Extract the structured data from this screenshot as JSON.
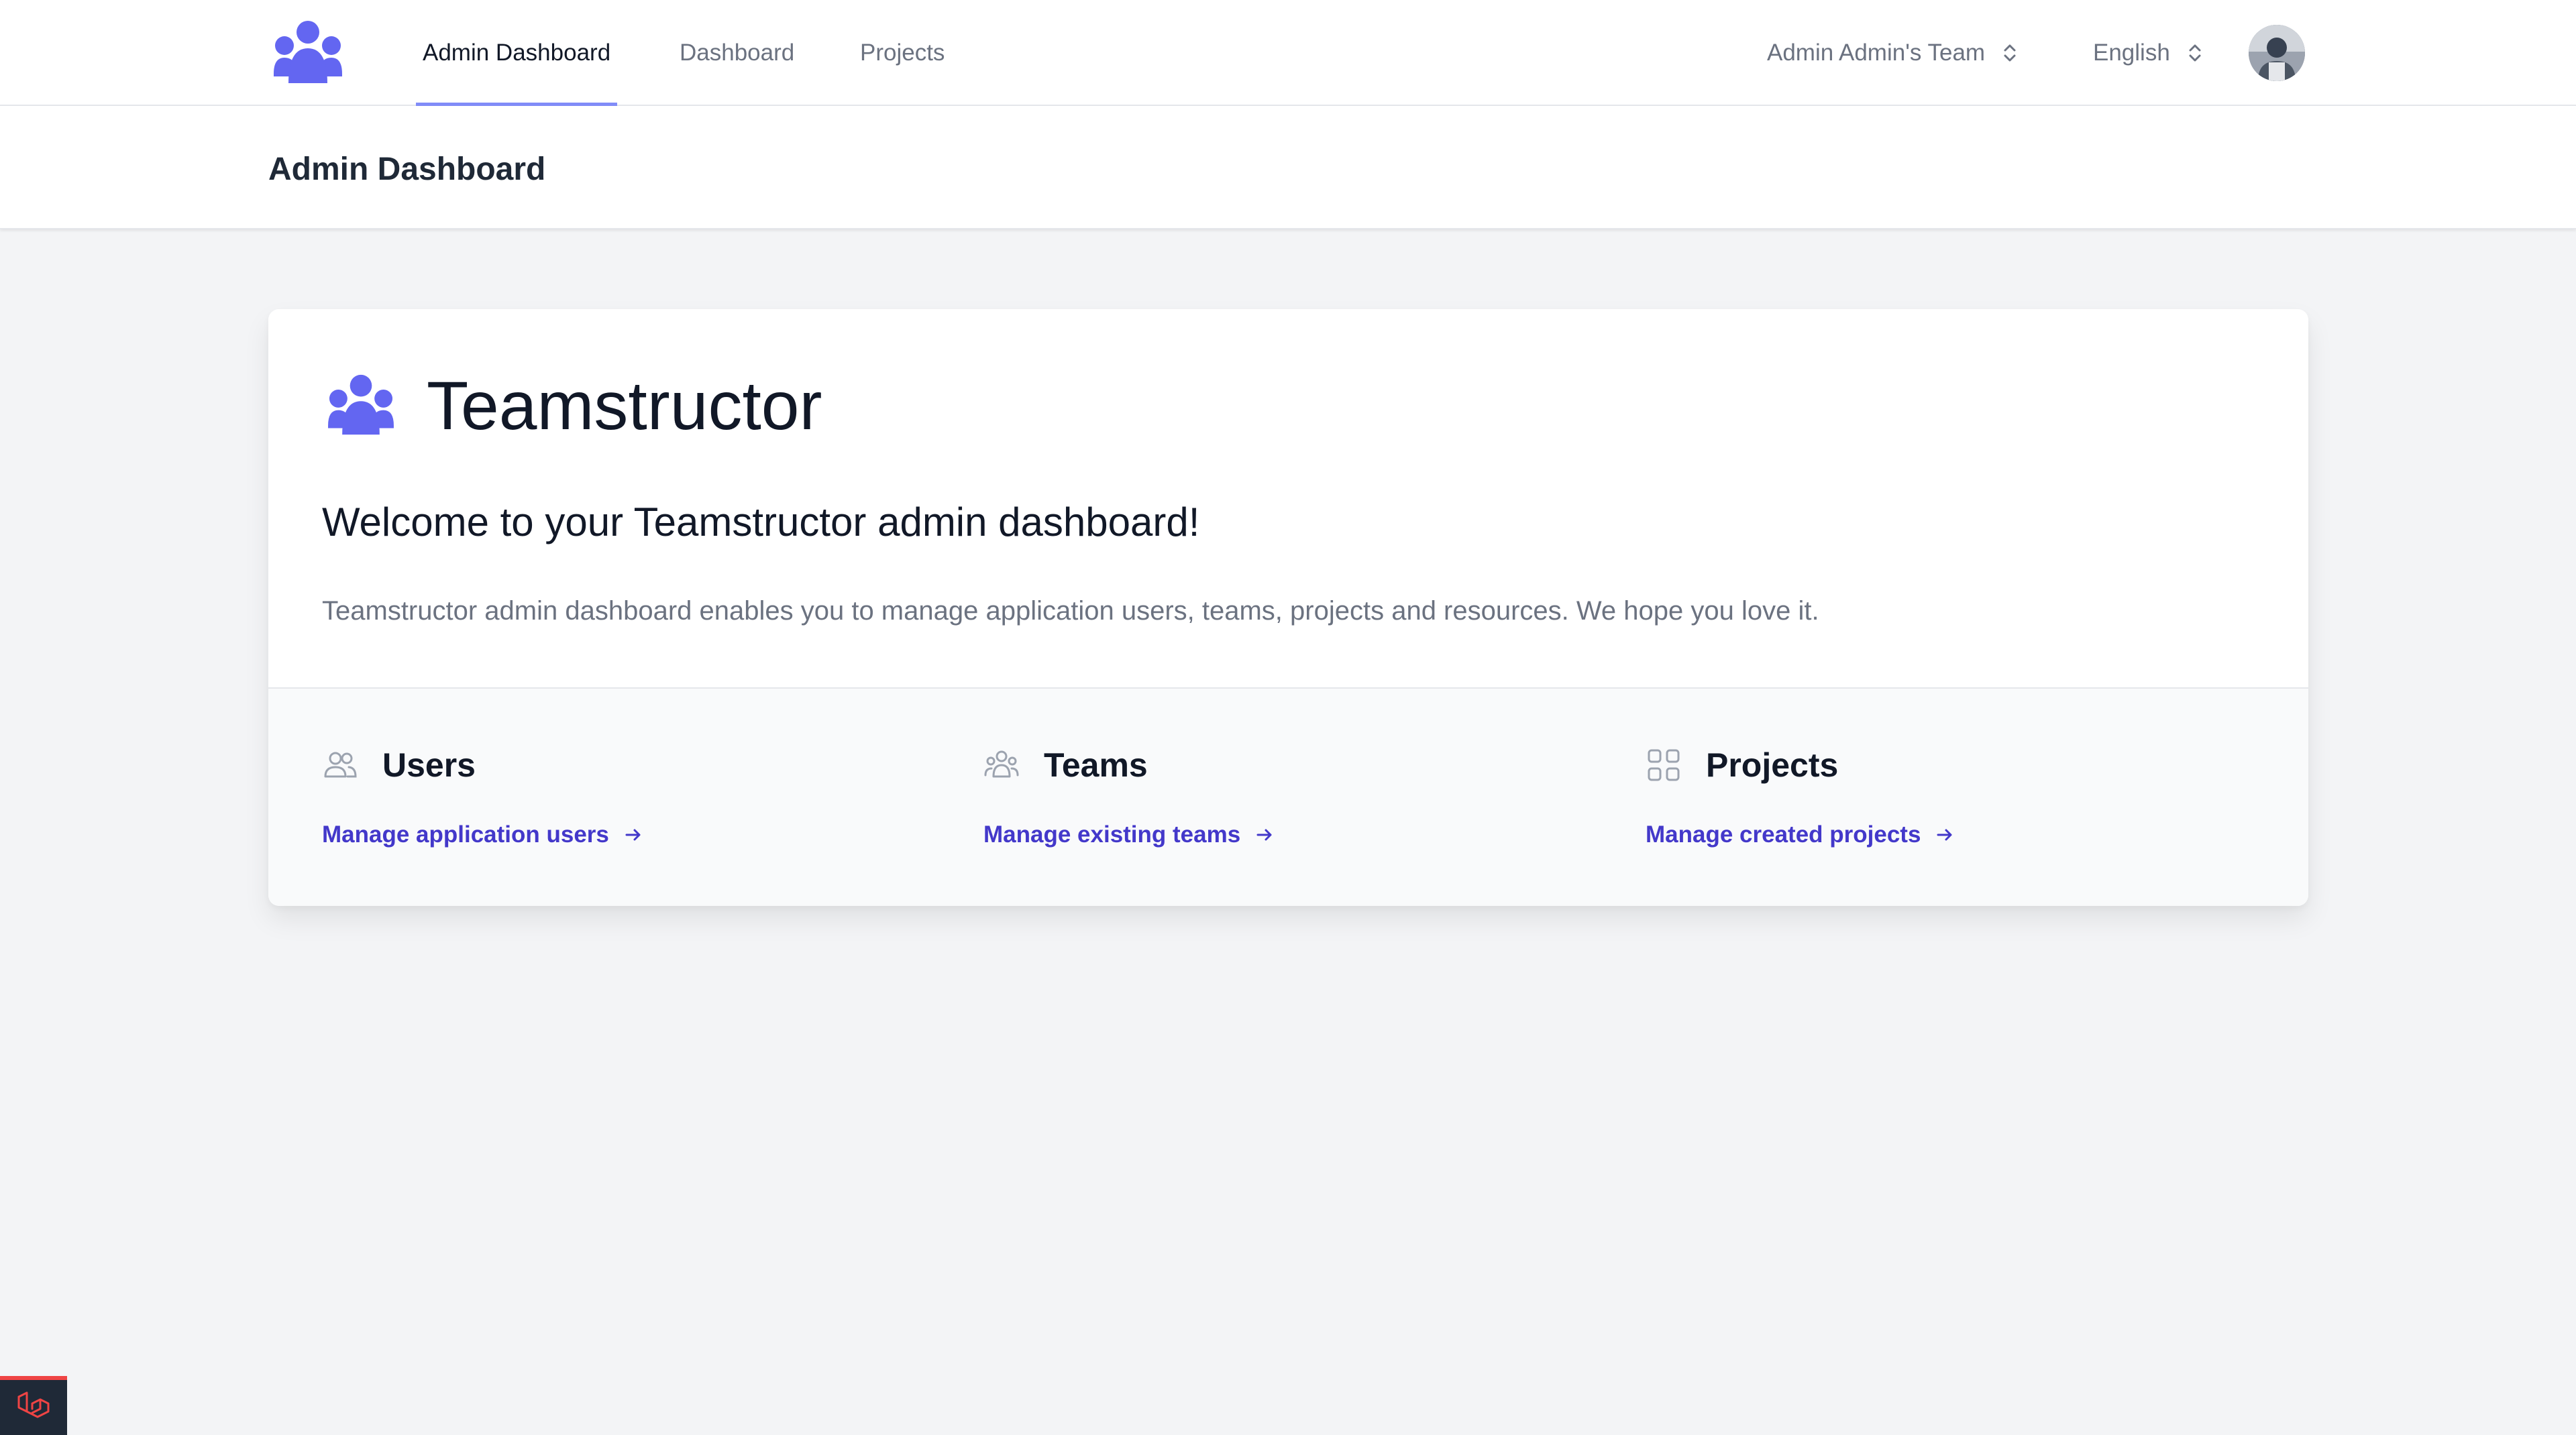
{
  "nav": {
    "items": [
      {
        "label": "Admin Dashboard",
        "active": true
      },
      {
        "label": "Dashboard",
        "active": false
      },
      {
        "label": "Projects",
        "active": false
      }
    ],
    "team_switcher": "Admin Admin's Team",
    "language_switcher": "English"
  },
  "header": {
    "title": "Admin Dashboard"
  },
  "card": {
    "brand": "Teamstructor",
    "welcome": "Welcome to your Teamstructor admin dashboard!",
    "description": "Teamstructor admin dashboard enables you to manage application users, teams, projects and resources. We hope you love it.",
    "features": [
      {
        "title": "Users",
        "link": "Manage application users",
        "icon": "users-icon"
      },
      {
        "title": "Teams",
        "link": "Manage existing teams",
        "icon": "teams-icon"
      },
      {
        "title": "Projects",
        "link": "Manage created projects",
        "icon": "grid-icon"
      }
    ]
  },
  "colors": {
    "accent": "#818cf8",
    "link": "#4338ca",
    "logo": "#6366f1",
    "background": "#f3f4f6"
  }
}
